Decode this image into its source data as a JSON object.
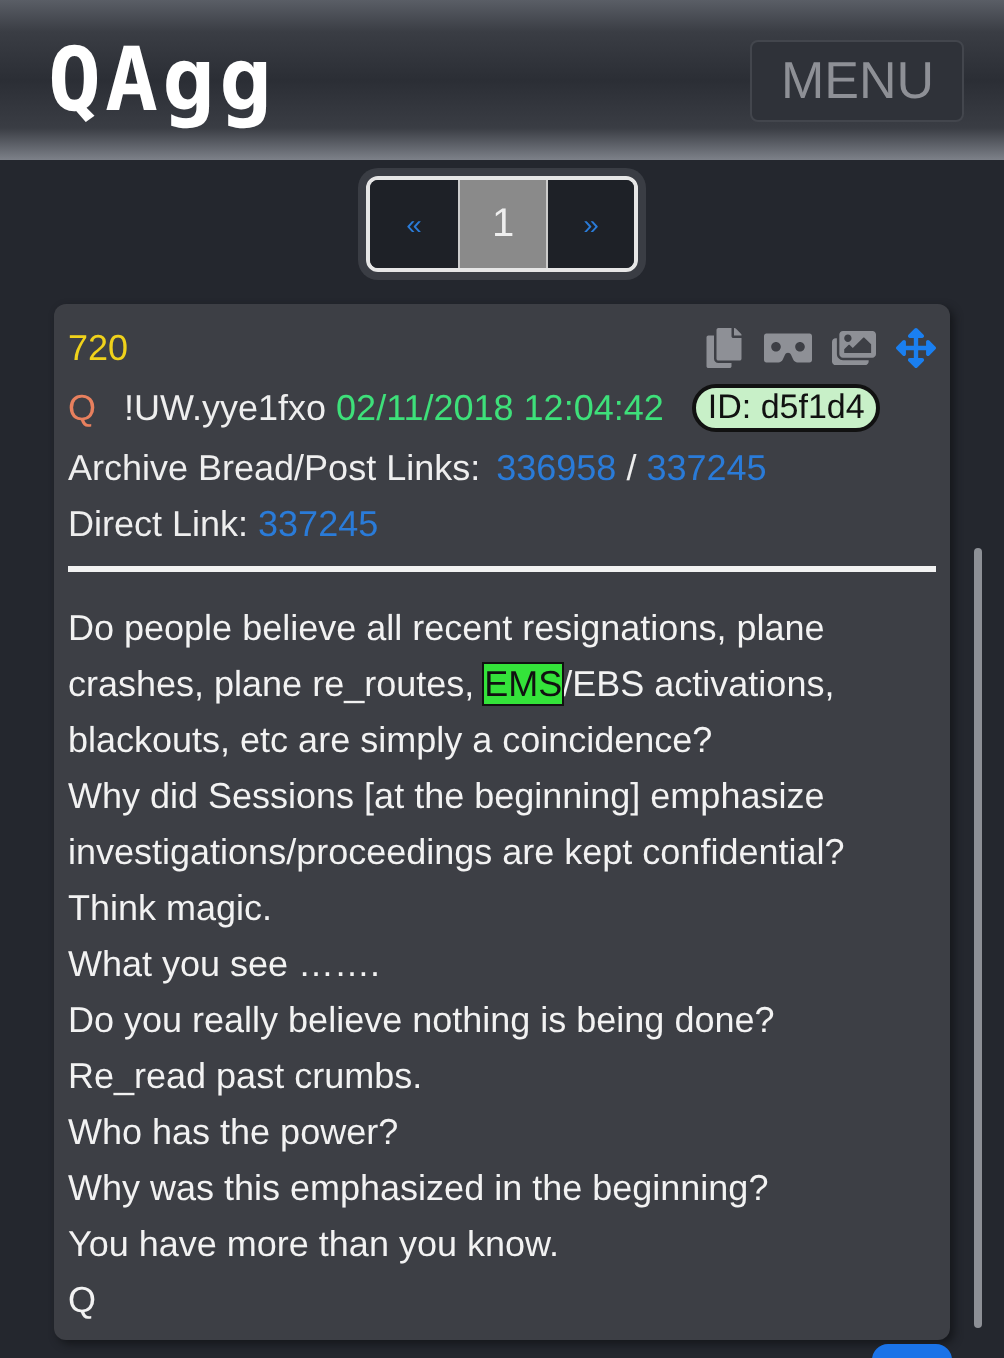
{
  "header": {
    "logo": "QAgg",
    "menu_button": "MENU"
  },
  "pagination": [
    {
      "label": "«",
      "kind": "prev",
      "selected": false
    },
    {
      "label": "1",
      "kind": "page",
      "selected": true
    },
    {
      "label": "»",
      "kind": "next",
      "selected": false
    }
  ],
  "post": {
    "number": "720",
    "author": "Q",
    "tripcode": "!UW.yye1fxo",
    "timestamp": "02/11/2018 12:04:42",
    "id_badge": "ID: d5f1d4",
    "archive_label": "Archive Bread/Post Links:",
    "archive_links": [
      "336958",
      "337245"
    ],
    "archive_separator": "/",
    "direct_label": "Direct Link:",
    "direct_link": "337245",
    "body": [
      [
        {
          "text": "Do people believe all recent resignations, plane crashes, plane re_routes, ",
          "highlight": false
        },
        {
          "text": "EMS",
          "highlight": true
        },
        {
          "text": "/EBS activations, blackouts, etc are simply a coincidence?",
          "highlight": false
        }
      ],
      [
        {
          "text": "Why did Sessions [at the beginning] emphasize investigations/proceedings are kept confidential?",
          "highlight": false
        }
      ],
      [
        {
          "text": "Think magic.",
          "highlight": false
        }
      ],
      [
        {
          "text": "What you see …….",
          "highlight": false
        }
      ],
      [
        {
          "text": "Do you really believe nothing is being done?",
          "highlight": false
        }
      ],
      [
        {
          "text": "Re_read past crumbs.",
          "highlight": false
        }
      ],
      [
        {
          "text": "Who has the power?",
          "highlight": false
        }
      ],
      [
        {
          "text": "Why was this emphasized in the beginning?",
          "highlight": false
        }
      ],
      [
        {
          "text": "You have more than you know.",
          "highlight": false
        }
      ],
      [
        {
          "text": "Q",
          "highlight": false
        }
      ]
    ]
  }
}
